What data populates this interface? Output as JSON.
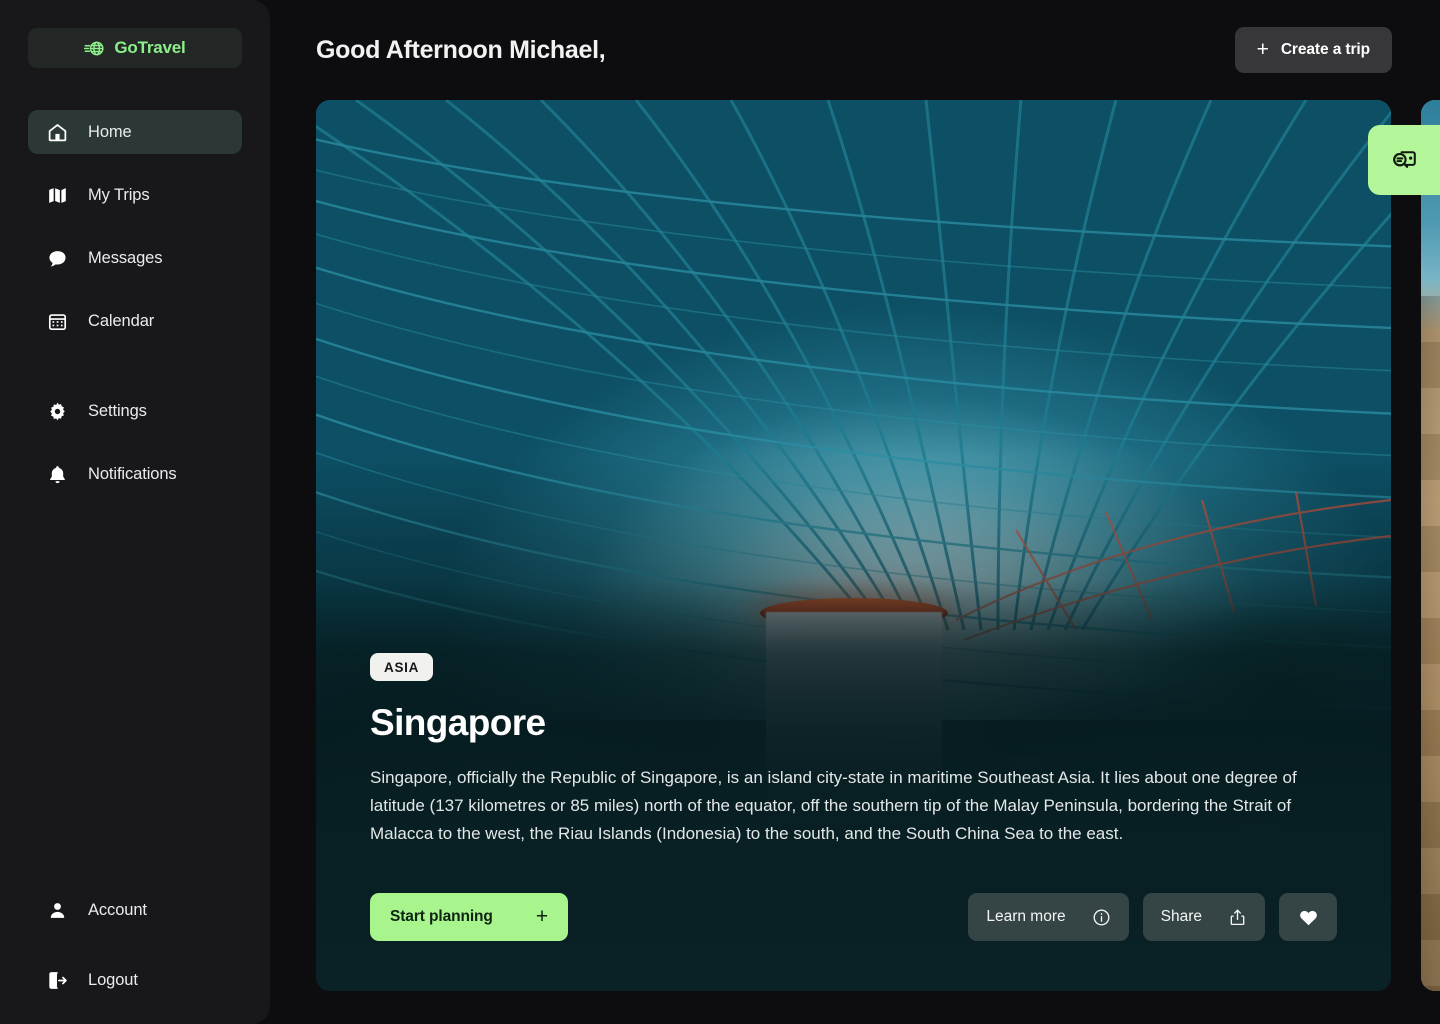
{
  "brand": {
    "name": "GoTravel",
    "logo_icon": "globe-motion-icon",
    "accent_green": "#8ef08a"
  },
  "sidebar": {
    "primary_items": [
      {
        "label": "Home",
        "icon": "home-icon",
        "active": true
      },
      {
        "label": "My Trips",
        "icon": "map-icon",
        "active": false
      },
      {
        "label": "Messages",
        "icon": "chat-bubble-icon",
        "active": false
      },
      {
        "label": "Calendar",
        "icon": "calendar-icon",
        "active": false
      }
    ],
    "secondary_items": [
      {
        "label": "Settings",
        "icon": "gear-icon",
        "active": false
      },
      {
        "label": "Notifications",
        "icon": "bell-icon",
        "active": false
      }
    ],
    "bottom_items": [
      {
        "label": "Account",
        "icon": "user-icon",
        "active": false
      },
      {
        "label": "Logout",
        "icon": "logout-icon",
        "active": false
      }
    ]
  },
  "header": {
    "greeting": "Good Afternoon Michael,",
    "create_trip_label": "Create a trip",
    "create_trip_icon": "plus-icon"
  },
  "floating_action": {
    "icon": "translate-chat-icon",
    "background": "#b4f79a"
  },
  "cards": [
    {
      "region": "ASIA",
      "title": "Singapore",
      "description": "Singapore, officially the Republic of Singapore, is an island city-state in maritime Southeast Asia. It lies about one degree of latitude (137 kilometres or 85 miles) north of the equator, off the southern tip of the Malay Peninsula, bordering the Strait of Malacca to the west, the Riau Islands (Indonesia) to the south, and the South China Sea to the east.",
      "image_alt": "Jewel Changi Airport Rain Vortex waterfall under a teal steel-and-glass dome",
      "actions": {
        "primary": {
          "label": "Start planning",
          "icon": "plus-icon",
          "color": "#a8f58e"
        },
        "learn_more": {
          "label": "Learn more",
          "icon": "info-icon"
        },
        "share": {
          "label": "Share",
          "icon": "share-icon"
        },
        "favorite": {
          "label": "",
          "icon": "heart-icon"
        }
      }
    },
    {
      "region": "",
      "title": "",
      "description": "",
      "image_alt": "Sunlit narrow street with sandstone buildings and a blue sky"
    }
  ],
  "colors": {
    "page_background": "#0d0d0f",
    "sidebar_background": "#18181b",
    "active_nav_background": "#2b3835",
    "card_background": "#0a2226",
    "button_surface": "#37373a"
  }
}
